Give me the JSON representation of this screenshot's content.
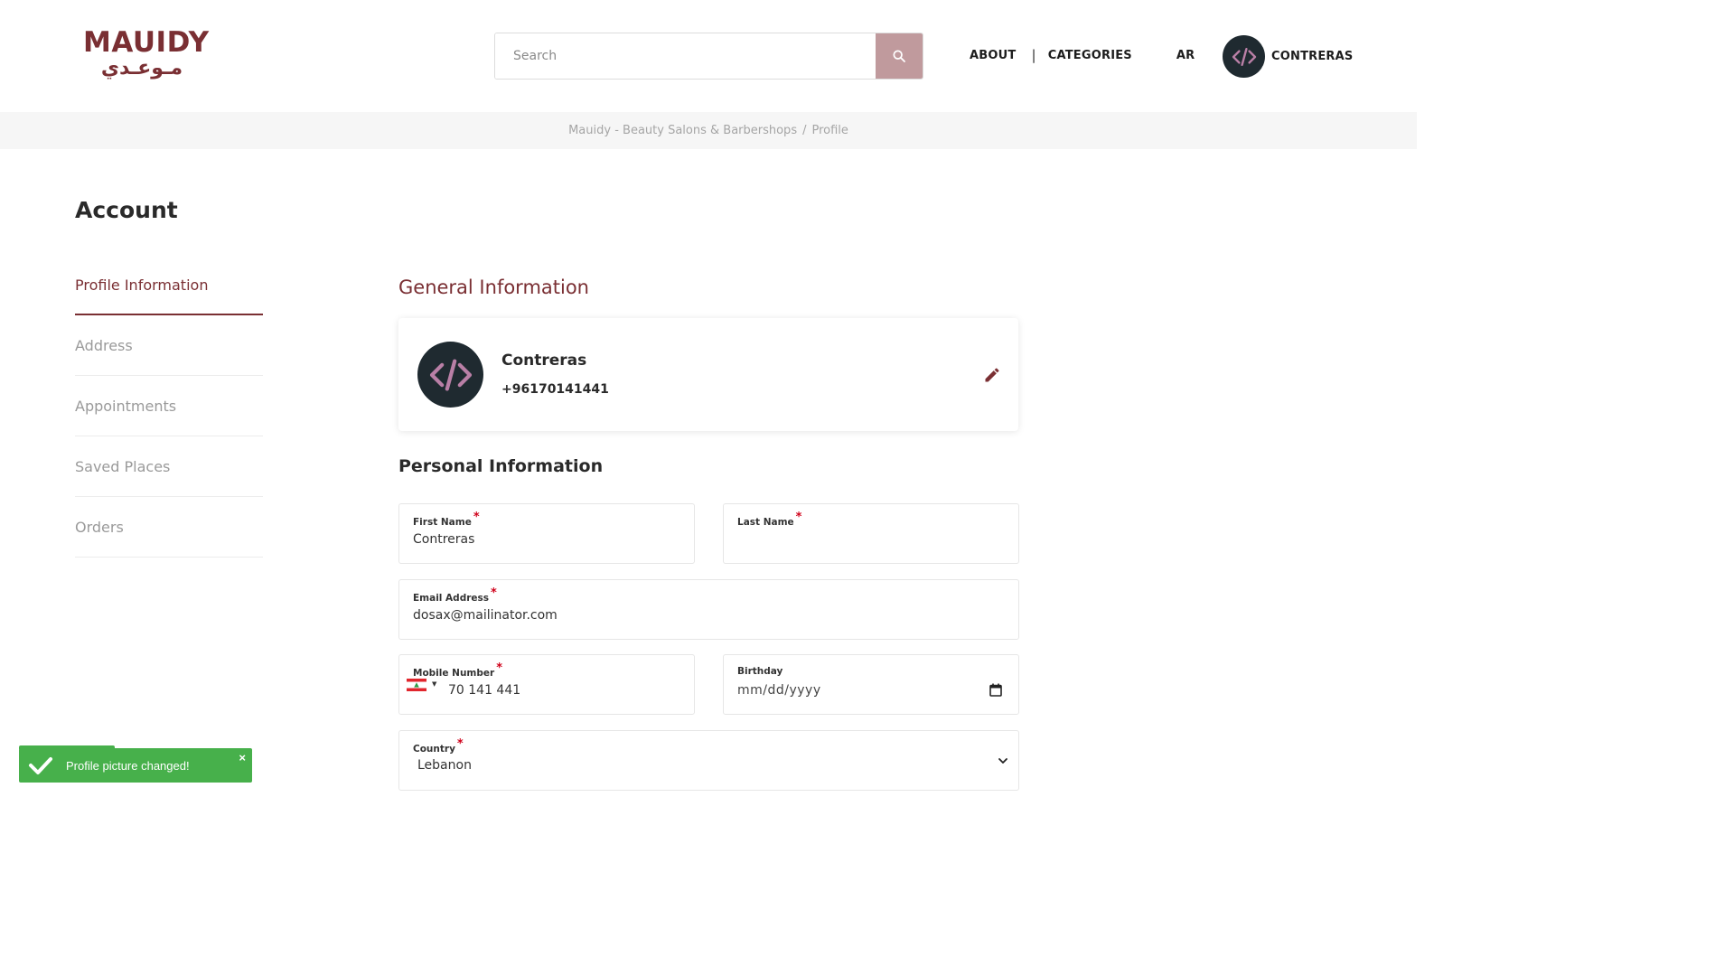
{
  "brand": {
    "logo_latin": "MAUIDY",
    "logo_arabic": "مـوعـدي",
    "primary_color": "#7a2f33",
    "search_button_color": "#c09a9d",
    "toast_color": "#47b04b"
  },
  "header": {
    "search_placeholder": "Search",
    "nav": {
      "about": "ABOUT",
      "separator": "|",
      "categories": "CATEGORIES",
      "language": "AR"
    },
    "user_name": "CONTRERAS",
    "avatar_icon": "code-icon"
  },
  "breadcrumb": {
    "home": "Mauidy - Beauty Salons & Barbershops",
    "separator": "/",
    "current": "Profile"
  },
  "account": {
    "title": "Account",
    "menu": [
      {
        "label": "Profile Information",
        "active": true
      },
      {
        "label": "Address",
        "active": false
      },
      {
        "label": "Appointments",
        "active": false
      },
      {
        "label": "Saved Places",
        "active": false
      },
      {
        "label": "Orders",
        "active": false
      }
    ]
  },
  "general": {
    "title": "General Information",
    "name": "Contreras",
    "phone": "+96170141441",
    "edit_icon": "pencil-icon"
  },
  "personal": {
    "title": "Personal Information",
    "required_mark": "*",
    "first_name": {
      "label": "First Name",
      "value": "Contreras"
    },
    "last_name": {
      "label": "Last Name",
      "value": ""
    },
    "email": {
      "label": "Email Address",
      "value": "dosax@mailinator.com"
    },
    "mobile": {
      "label": "Mobile Number",
      "value": "70 141 441",
      "country_flag": "lebanon-flag"
    },
    "birthday": {
      "label": "Birthday",
      "placeholder": "mm/dd/yyyy"
    },
    "country": {
      "label": "Country",
      "value": "Lebanon"
    }
  },
  "toast": {
    "message": "Profile picture changed!",
    "close": "×"
  }
}
